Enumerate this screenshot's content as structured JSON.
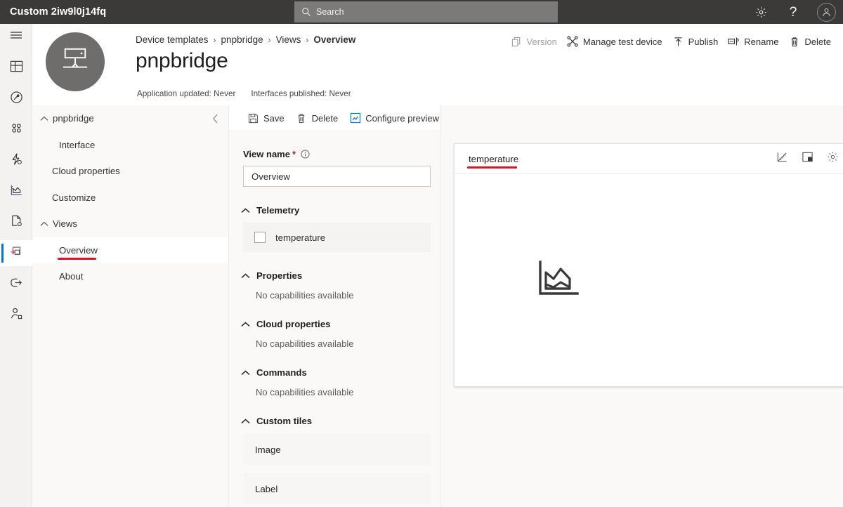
{
  "topbar": {
    "app_title": "Custom 2iw9l0j14fq",
    "search_placeholder": "Search",
    "settings_icon": "gear-icon",
    "help_icon": "question-mark-icon",
    "account_icon": "person-avatar-icon"
  },
  "rail": {
    "items": [
      {
        "name": "hamburger-menu",
        "icon": "hamburger-icon",
        "selected": false
      },
      {
        "name": "dashboard",
        "icon": "dashboard-grid-icon",
        "selected": false
      },
      {
        "name": "devices",
        "icon": "devices-circle-icon",
        "selected": false
      },
      {
        "name": "device-groups",
        "icon": "four-dots-icon",
        "selected": false
      },
      {
        "name": "rules",
        "icon": "lightning-gear-icon",
        "selected": false
      },
      {
        "name": "analytics",
        "icon": "area-chart-icon",
        "selected": false
      },
      {
        "name": "jobs",
        "icon": "document-gear-icon",
        "selected": false
      },
      {
        "name": "device-templates",
        "icon": "device-template-plus-icon",
        "selected": true
      },
      {
        "name": "data-export",
        "icon": "export-arrow-icon",
        "selected": false
      },
      {
        "name": "administration",
        "icon": "person-settings-icon",
        "selected": false
      }
    ]
  },
  "header": {
    "thumbnail_icon": "gateway-device-icon",
    "breadcrumb": [
      {
        "label": "Device templates",
        "current": false
      },
      {
        "label": "pnpbridge",
        "current": false
      },
      {
        "label": "Views",
        "current": false
      },
      {
        "label": "Overview",
        "current": true
      }
    ],
    "breadcrumb_separator": "›",
    "title": "pnpbridge",
    "meta": [
      "Application updated: Never",
      "Interfaces published: Never"
    ],
    "commands": [
      {
        "label": "Version",
        "icon": "copy-version-icon",
        "disabled": true
      },
      {
        "label": "Manage test device",
        "icon": "connector-scissors-icon",
        "disabled": false
      },
      {
        "label": "Publish",
        "icon": "up-arrow-icon",
        "disabled": false
      },
      {
        "label": "Rename",
        "icon": "rename-tag-icon",
        "disabled": false
      },
      {
        "label": "Delete",
        "icon": "trash-icon",
        "disabled": false
      }
    ]
  },
  "tree": {
    "collapse_icon": "chevron-left-icon",
    "rows": [
      {
        "label": "pnpbridge",
        "level": 0,
        "chevron": "chevron-up-icon",
        "selected": false,
        "annotated": false
      },
      {
        "label": "Interface",
        "level": 1,
        "chevron": "",
        "selected": false,
        "annotated": false
      },
      {
        "label": "Cloud properties",
        "level": 2,
        "chevron": "",
        "selected": false,
        "annotated": false
      },
      {
        "label": "Customize",
        "level": 2,
        "chevron": "",
        "selected": false,
        "annotated": false
      },
      {
        "label": "Views",
        "level": 0,
        "chevron": "chevron-up-icon",
        "selected": false,
        "annotated": false
      },
      {
        "label": "Overview",
        "level": 1,
        "chevron": "",
        "selected": true,
        "annotated": true
      },
      {
        "label": "About",
        "level": 1,
        "chevron": "",
        "selected": false,
        "annotated": false
      }
    ]
  },
  "form": {
    "toolbar": [
      {
        "label": "Save",
        "icon": "save-floppy-icon"
      },
      {
        "label": "Delete",
        "icon": "trash-icon"
      },
      {
        "label": "Configure preview device",
        "icon": "chart-box-icon"
      }
    ],
    "view_name_label": "View name",
    "required_marker": "*",
    "info_icon": "info-circle-icon",
    "view_name_value": "Overview",
    "sections": [
      {
        "title": "Telemetry",
        "chevron": "chevron-up-icon",
        "capabilities": [
          {
            "label": "temperature",
            "checked": false
          }
        ],
        "empty_text": ""
      },
      {
        "title": "Properties",
        "chevron": "chevron-up-icon",
        "capabilities": [],
        "empty_text": "No capabilities available"
      },
      {
        "title": "Cloud properties",
        "chevron": "chevron-up-icon",
        "capabilities": [],
        "empty_text": "No capabilities available"
      },
      {
        "title": "Commands",
        "chevron": "chevron-up-icon",
        "capabilities": [],
        "empty_text": "No capabilities available"
      }
    ],
    "custom_tiles": {
      "title": "Custom tiles",
      "chevron": "chevron-up-icon",
      "items": [
        "Image",
        "Label"
      ]
    }
  },
  "canvas": {
    "tile": {
      "title": "temperature",
      "annotated": true,
      "actions": [
        {
          "name": "chart-type-icon",
          "icon": "line-chart-ruler-icon"
        },
        {
          "name": "resize-tile-icon",
          "icon": "square-quadrant-icon"
        },
        {
          "name": "tile-settings-icon",
          "icon": "gear-icon"
        }
      ],
      "placeholder_icon": "area-chart-placeholder-icon"
    }
  },
  "colors": {
    "topbar_bg": "#3b3a39",
    "accent": "#0078d4",
    "annotation_red": "#e81123",
    "panel_bg": "#faf9f8",
    "required_red": "#a4262c"
  }
}
